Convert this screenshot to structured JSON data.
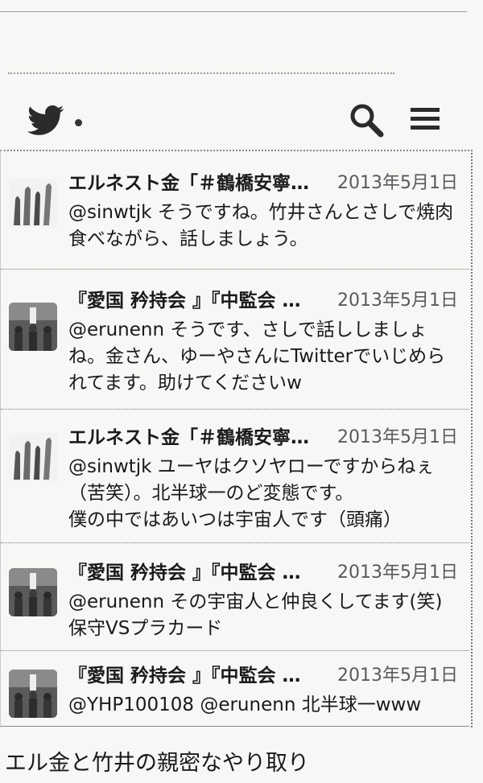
{
  "header": {
    "logo_icon": "twitter-bird-icon",
    "search_icon": "search-icon",
    "menu_icon": "hamburger-menu-icon"
  },
  "tweets": [
    {
      "avatar": "hands-avatar",
      "name": "エルネスト金「＃鶴橋安寧…",
      "date": "2013年5月1日",
      "text": "@sinwtjk そうですね。竹井さんとさしで焼肉食べながら、話しましょう。"
    },
    {
      "avatar": "group-photo-avatar",
      "name": "『愛国 矜持会 』『中監会 …",
      "date": "2013年5月1日",
      "text": "@erunenn そうです、さしで話ししましょね。金さん、ゆーやさんにTwitterでいじめられてます。助けてくださいw"
    },
    {
      "avatar": "hands-avatar",
      "name": "エルネスト金「＃鶴橋安寧…",
      "date": "2013年5月1日",
      "text": "@sinwtjk ユーヤはクソヤローですからねぇ（苦笑）。北半球一のど変態です。\n僕の中ではあいつは宇宙人です（頭痛）"
    },
    {
      "avatar": "group-photo-avatar",
      "name": "『愛国 矜持会 』『中監会 …",
      "date": "2013年5月1日",
      "text": "@erunenn その宇宙人と仲良くしてます(笑)\n保守VSプラカード"
    },
    {
      "avatar": "group-photo-avatar",
      "name": "『愛国 矜持会 』『中監会 …",
      "date": "2013年5月1日",
      "text": "@YHP100108 @erunenn 北半球一www"
    }
  ],
  "caption": "エル金と竹井の親密なやり取り"
}
